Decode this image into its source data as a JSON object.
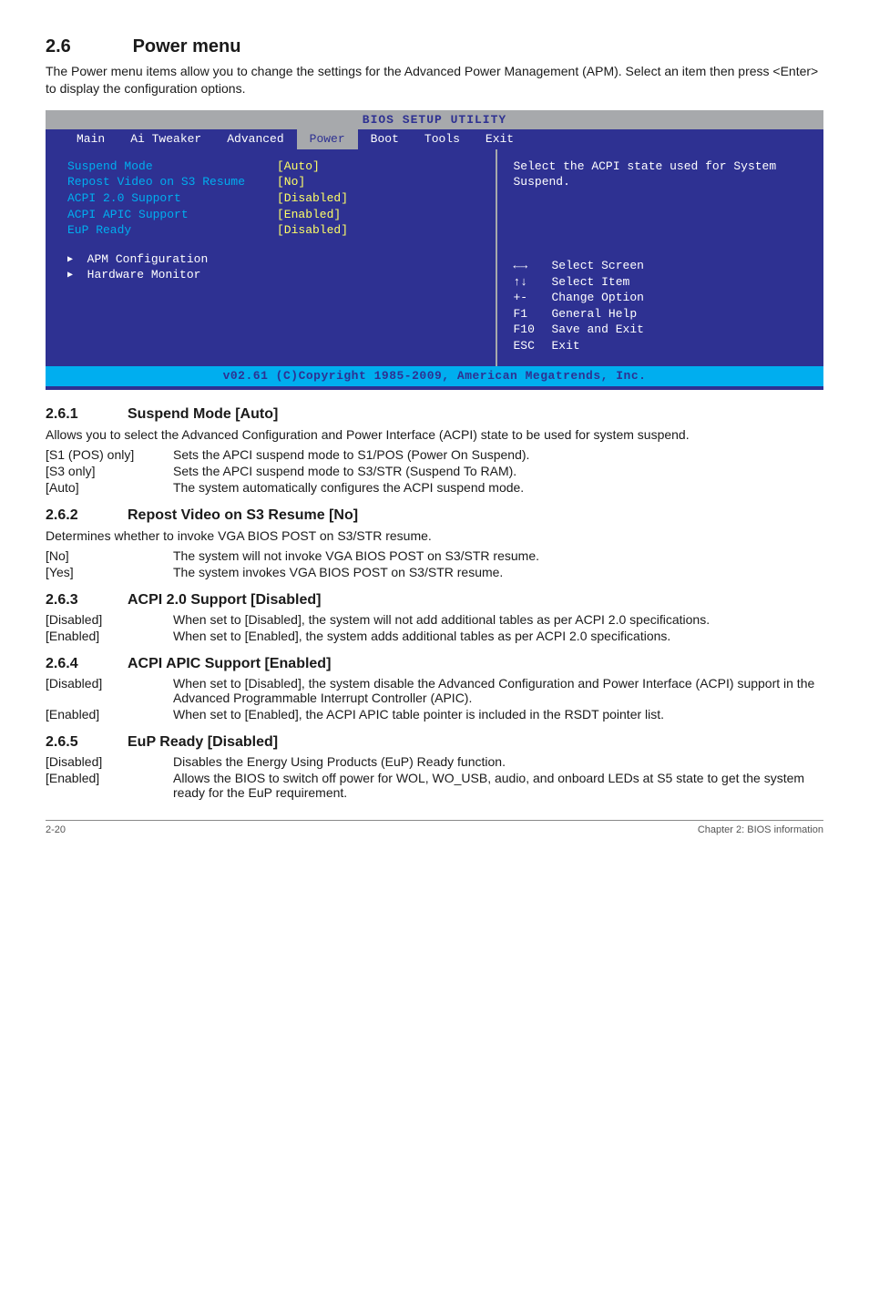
{
  "h1_num": "2.6",
  "h1_title": "Power menu",
  "intro": "The Power menu items allow you to change the settings for the Advanced Power Management (APM). Select an item then press <Enter> to display the configuration options.",
  "bios": {
    "title": "BIOS SETUP UTILITY",
    "tabs": {
      "main": "Main",
      "ai": "Ai Tweaker",
      "adv": "Advanced",
      "power": "Power",
      "boot": "Boot",
      "tools": "Tools",
      "exit": "Exit"
    },
    "rows": [
      {
        "label": "Suspend Mode",
        "val": "[Auto]"
      },
      {
        "label": "Repost Video on S3 Resume",
        "val": "[No]"
      },
      {
        "label": "ACPI 2.0 Support",
        "val": "[Disabled]"
      },
      {
        "label": "ACPI APIC Support",
        "val": "[Enabled]"
      },
      {
        "label": "EuP Ready",
        "val": "[Disabled]"
      }
    ],
    "subs": {
      "apm": "APM Configuration",
      "hw": "Hardware Monitor"
    },
    "right_head": "Select the ACPI state used for System Suspend.",
    "nav": {
      "lr": "Select Screen",
      "ud": "Select Item",
      "pm": "Change Option",
      "f1": "General Help",
      "f10": "Save and Exit",
      "esc": "Exit",
      "lr_k": "←→",
      "ud_k": "↑↓",
      "pm_k": "+-",
      "f1_k": "F1",
      "f10_k": "F10",
      "esc_k": "ESC"
    },
    "footer": "v02.61 (C)Copyright 1985-2009, American Megatrends, Inc."
  },
  "s261_num": "2.6.1",
  "s261_h": "Suspend Mode [Auto]",
  "s261_p": "Allows you to select the Advanced Configuration and Power Interface (ACPI) state to be used for system suspend.",
  "s261_r": [
    {
      "k": "[S1 (POS) only]",
      "v": "Sets the APCI suspend mode to S1/POS (Power On Suspend)."
    },
    {
      "k": "[S3 only]",
      "v": "Sets the APCI suspend mode to S3/STR (Suspend To RAM)."
    },
    {
      "k": "[Auto]",
      "v": "The system automatically configures the ACPI suspend mode."
    }
  ],
  "s262_num": "2.6.2",
  "s262_h": "Repost Video on S3 Resume [No]",
  "s262_p": "Determines whether to invoke VGA BIOS POST on S3/STR resume.",
  "s262_r": [
    {
      "k": "[No]",
      "v": "The system will not invoke VGA BIOS POST on S3/STR resume."
    },
    {
      "k": "[Yes]",
      "v": "The system invokes VGA BIOS POST on S3/STR resume."
    }
  ],
  "s263_num": "2.6.3",
  "s263_h": "ACPI 2.0 Support [Disabled]",
  "s263_r": [
    {
      "k": "[Disabled]",
      "v": "When set to [Disabled], the system will not add additional tables as per ACPI 2.0 specifications."
    },
    {
      "k": "[Enabled]",
      "v": "When set to [Enabled], the system adds additional tables as per ACPI 2.0 specifications."
    }
  ],
  "s264_num": "2.6.4",
  "s264_h": "ACPI APIC Support [Enabled]",
  "s264_r": [
    {
      "k": "[Disabled]",
      "v": "When set to [Disabled], the system disable the Advanced Configuration and Power Interface (ACPI) support in the Advanced Programmable Interrupt Controller (APIC)."
    },
    {
      "k": "[Enabled]",
      "v": "When set to [Enabled], the ACPI APIC table pointer is included in the RSDT pointer list."
    }
  ],
  "s265_num": "2.6.5",
  "s265_h": "EuP Ready [Disabled]",
  "s265_r": [
    {
      "k": "[Disabled]",
      "v": "Disables the Energy Using Products (EuP) Ready function."
    },
    {
      "k": "[Enabled]",
      "v": "Allows the BIOS to switch off power for WOL, WO_USB, audio, and onboard LEDs at S5 state to get the system ready for the EuP requirement."
    }
  ],
  "footer_left": "2-20",
  "footer_right": "Chapter 2: BIOS information"
}
